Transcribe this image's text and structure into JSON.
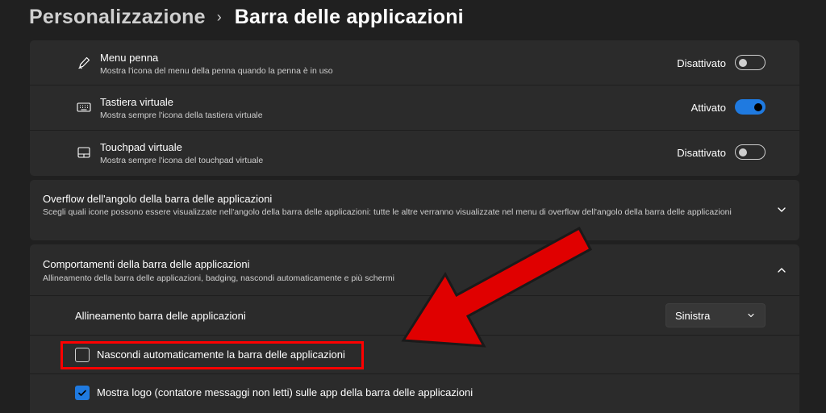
{
  "breadcrumb": {
    "parent": "Personalizzazione",
    "separator": "›",
    "current": "Barra delle applicazioni"
  },
  "pen_menu": {
    "title": "Menu penna",
    "description": "Mostra l'icona del menu della penna quando la penna è in uso",
    "state_label": "Disattivato",
    "on": false,
    "icon": "pen-icon"
  },
  "touch_keyboard": {
    "title": "Tastiera virtuale",
    "description": "Mostra sempre l'icona della tastiera virtuale",
    "state_label": "Attivato",
    "on": true,
    "icon": "keyboard-icon"
  },
  "virtual_touchpad": {
    "title": "Touchpad virtuale",
    "description": "Mostra sempre l'icona del touchpad virtuale",
    "state_label": "Disattivato",
    "on": false,
    "icon": "touchpad-icon"
  },
  "overflow_section": {
    "title": "Overflow dell'angolo della barra delle applicazioni",
    "description": "Scegli quali icone possono essere visualizzate nell'angolo della barra delle applicazioni: tutte le altre verranno visualizzate nel menu di overflow dell'angolo della barra delle applicazioni",
    "expanded": false
  },
  "behaviors_section": {
    "title": "Comportamenti della barra delle applicazioni",
    "description": "Allineamento della barra delle applicazioni, badging, nascondi automaticamente e più schermi",
    "expanded": true,
    "alignment": {
      "label": "Allineamento barra delle applicazioni",
      "value": "Sinistra"
    },
    "autohide": {
      "label": "Nascondi automaticamente la barra delle applicazioni",
      "checked": false
    },
    "badges": {
      "label": "Mostra logo (contatore messaggi non letti) sulle app della barra delle applicazioni",
      "checked": true
    }
  },
  "colors": {
    "background": "#202020",
    "card": "#2b2b2b",
    "accent": "#1f7ae0",
    "annotation": "#ff0000"
  }
}
